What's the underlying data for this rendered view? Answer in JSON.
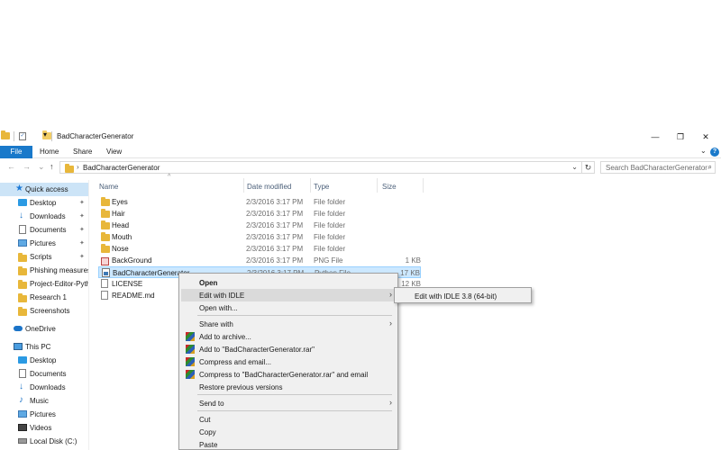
{
  "window": {
    "title": "BadCharacterGenerator"
  },
  "titlebar": {
    "qa_dropdown": "▾",
    "minimize": "—",
    "restore": "❐",
    "close": "✕"
  },
  "ribbon": {
    "file": "File",
    "tabs": [
      "Home",
      "Share",
      "View"
    ],
    "expand": "⌄",
    "help": "?"
  },
  "address": {
    "back": "←",
    "forward": "→",
    "recent": "⌄",
    "up": "↑",
    "chevron": "›",
    "path": "BadCharacterGenerator",
    "dropdown": "⌄",
    "refresh": "↻",
    "search_placeholder": "Search BadCharacterGenerator",
    "search_icon": "⌕"
  },
  "nav": {
    "items": [
      {
        "label": "Quick access",
        "icon": "star-icon",
        "pinned": false,
        "selected": true
      },
      {
        "label": "Desktop",
        "icon": "desktop-icon",
        "pinned": true
      },
      {
        "label": "Downloads",
        "icon": "download-icon",
        "pinned": true
      },
      {
        "label": "Documents",
        "icon": "documents-icon",
        "pinned": true
      },
      {
        "label": "Pictures",
        "icon": "pictures-icon",
        "pinned": true
      },
      {
        "label": "Scripts",
        "icon": "folder-icon",
        "pinned": true
      },
      {
        "label": "Phishing measures",
        "icon": "folder-icon",
        "pinned": false
      },
      {
        "label": "Project-Editor-Pyth",
        "icon": "folder-icon",
        "pinned": false
      },
      {
        "label": "Research 1",
        "icon": "folder-icon",
        "pinned": false
      },
      {
        "label": "Screenshots",
        "icon": "folder-icon",
        "pinned": false
      },
      {
        "label": "OneDrive",
        "icon": "onedrive-icon",
        "pinned": false
      },
      {
        "label": "This PC",
        "icon": "pc-icon",
        "pinned": false
      },
      {
        "label": "Desktop",
        "icon": "desktop-icon",
        "pinned": false
      },
      {
        "label": "Documents",
        "icon": "documents-icon",
        "pinned": false
      },
      {
        "label": "Downloads",
        "icon": "download-icon",
        "pinned": false
      },
      {
        "label": "Music",
        "icon": "music-icon",
        "pinned": false
      },
      {
        "label": "Pictures",
        "icon": "pictures-icon",
        "pinned": false
      },
      {
        "label": "Videos",
        "icon": "videos-icon",
        "pinned": false
      },
      {
        "label": "Local Disk (C:)",
        "icon": "disk-icon",
        "pinned": false
      }
    ],
    "pin_glyph": "✦",
    "star_glyph": "★",
    "download_glyph": "↓",
    "music_glyph": "♪"
  },
  "columns": {
    "name": "Name",
    "date": "Date modified",
    "type": "Type",
    "size": "Size",
    "sort_indicator": "^"
  },
  "files": [
    {
      "name": "Eyes",
      "date": "2/3/2016 3:17 PM",
      "type": "File folder",
      "size": "",
      "icon": "folder-icon"
    },
    {
      "name": "Hair",
      "date": "2/3/2016 3:17 PM",
      "type": "File folder",
      "size": "",
      "icon": "folder-icon"
    },
    {
      "name": "Head",
      "date": "2/3/2016 3:17 PM",
      "type": "File folder",
      "size": "",
      "icon": "folder-icon"
    },
    {
      "name": "Mouth",
      "date": "2/3/2016 3:17 PM",
      "type": "File folder",
      "size": "",
      "icon": "folder-icon"
    },
    {
      "name": "Nose",
      "date": "2/3/2016 3:17 PM",
      "type": "File folder",
      "size": "",
      "icon": "folder-icon"
    },
    {
      "name": "BackGround",
      "date": "2/3/2016 3:17 PM",
      "type": "PNG File",
      "size": "1 KB",
      "icon": "png-file-icon"
    },
    {
      "name": "BadCharacterGenerator",
      "date": "2/3/2016 3:17 PM",
      "type": "Python File",
      "size": "17 KB",
      "icon": "python-file-icon",
      "selected": true
    },
    {
      "name": "LICENSE",
      "date": "",
      "type": "",
      "size": "12 KB",
      "icon": "text-file-icon"
    },
    {
      "name": "README.md",
      "date": "",
      "type": "",
      "size": "",
      "icon": "text-file-icon"
    }
  ],
  "context_menu": {
    "items": [
      {
        "label": "Open",
        "bold": true
      },
      {
        "label": "Edit with IDLE",
        "arrow": true,
        "highlight": true
      },
      {
        "label": "Open with..."
      },
      {
        "separator": true
      },
      {
        "label": "Share with",
        "arrow": true
      },
      {
        "label": "Add to archive...",
        "icon": "winrar-icon"
      },
      {
        "label": "Add to \"BadCharacterGenerator.rar\"",
        "icon": "winrar-icon"
      },
      {
        "label": "Compress and email...",
        "icon": "winrar-icon"
      },
      {
        "label": "Compress to \"BadCharacterGenerator.rar\" and email",
        "icon": "winrar-icon"
      },
      {
        "label": "Restore previous versions"
      },
      {
        "separator": true
      },
      {
        "label": "Send to",
        "arrow": true
      },
      {
        "separator": true
      },
      {
        "label": "Cut"
      },
      {
        "label": "Copy"
      },
      {
        "label": "Paste"
      }
    ],
    "arrow_glyph": "›"
  },
  "submenu": {
    "label": "Edit with IDLE 3.8 (64-bit)"
  }
}
